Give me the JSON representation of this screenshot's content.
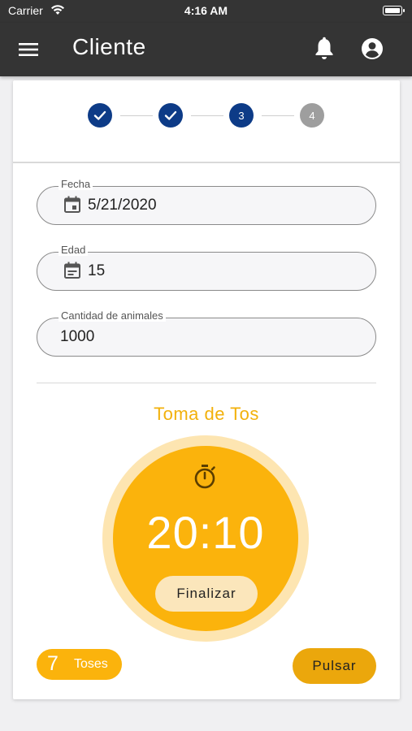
{
  "status_bar": {
    "carrier": "Carrier",
    "time": "4:16 AM"
  },
  "app_bar": {
    "title": "Cliente",
    "icons": [
      "menu-icon",
      "bell-icon",
      "account-circle-icon"
    ]
  },
  "stepper": {
    "steps": [
      {
        "label": "",
        "state": "done",
        "icon": "check-icon"
      },
      {
        "label": "",
        "state": "done",
        "icon": "check-icon"
      },
      {
        "label": "3",
        "state": "active"
      },
      {
        "label": "4",
        "state": "pending"
      }
    ],
    "colors": {
      "active": "#0d3b87",
      "pending": "#9e9e9e"
    }
  },
  "form": {
    "fecha": {
      "label": "Fecha",
      "value": "5/21/2020",
      "icon": "calendar-icon"
    },
    "edad": {
      "label": "Edad",
      "value": "15",
      "icon": "event-note-icon"
    },
    "cantidad": {
      "label": "Cantidad de animales",
      "value": "1000"
    }
  },
  "cough": {
    "title": "Toma de Tos",
    "timer": "20:10",
    "finish_label": "Finalizar",
    "count": "7",
    "count_label": "Toses",
    "pulse_label": "Pulsar",
    "icon": "stopwatch-icon",
    "colors": {
      "accent": "#fbb30c",
      "title": "#f2b10b"
    }
  }
}
